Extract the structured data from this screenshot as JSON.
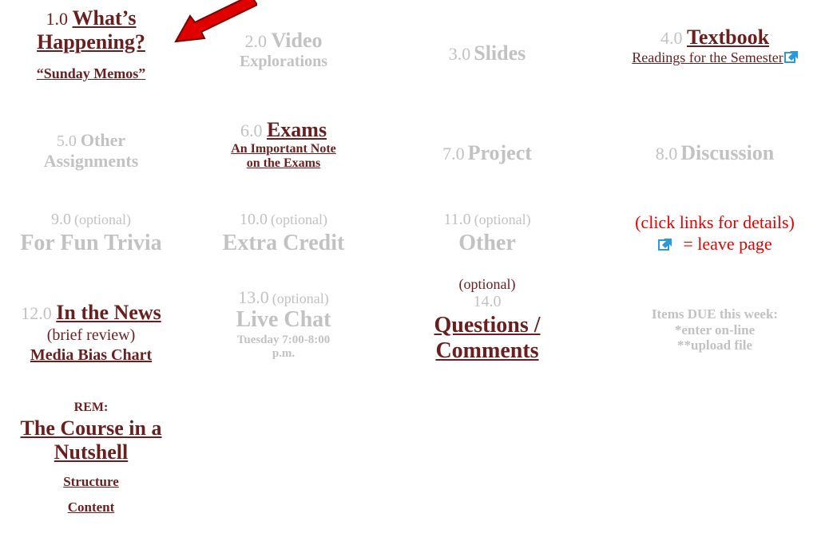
{
  "c1": {
    "num": "1.0",
    "title": "What’s Happening?",
    "sub": "“Sunday Memos”"
  },
  "c2": {
    "num": "2.0",
    "title_a": "Video",
    "title_b": "Explorations"
  },
  "c3": {
    "num": "3.0",
    "title": "Slides"
  },
  "c4": {
    "num": "4.0",
    "title": "Textbook",
    "sub": "Readings for the Semester"
  },
  "c5": {
    "num": "5.0",
    "title_a": "Other",
    "title_b": "Assignments"
  },
  "c6": {
    "num": "6.0",
    "title": "Exams",
    "sub_a": "An Important Note",
    "sub_b": "on the Exams"
  },
  "c7": {
    "num": "7.0",
    "title": "Project"
  },
  "c8": {
    "num": "8.0",
    "title": "Discussion"
  },
  "c9": {
    "num": "9.0",
    "opt": "(optional)",
    "title": "For Fun Trivia"
  },
  "c10": {
    "num": "10.0",
    "opt": "(optional)",
    "title": "Extra Credit"
  },
  "c11": {
    "num": "11.0",
    "opt": "(optional)",
    "title": "Other"
  },
  "legend": {
    "line1": "(click links for details)",
    "line2": "= leave page"
  },
  "c12": {
    "num": "12.0",
    "title": "In the News",
    "sub": "(brief review)",
    "link": "Media Bias Chart"
  },
  "c13": {
    "num": "13.0",
    "opt": "(optional)",
    "title": "Live Chat",
    "sub_a": "Tuesday 7:00-8:00",
    "sub_b": "p.m."
  },
  "c14": {
    "opt": "(optional)",
    "num": "14.0",
    "title_a": "Questions /",
    "title_b": "Comments"
  },
  "due": {
    "line1": "Items DUE this week:",
    "line2": "*enter on-line",
    "line3": "**upload file"
  },
  "rem": {
    "label": "REM:",
    "title_a": "The Course in a",
    "title_b": "Nutshell",
    "structure": "Structure",
    "content": "Content"
  },
  "colors": {
    "link": "#6b1e1e",
    "muted": "#c2c2c2",
    "alert": "#e60000",
    "arrow": "#e00000",
    "icon": "#2a9ad8"
  }
}
